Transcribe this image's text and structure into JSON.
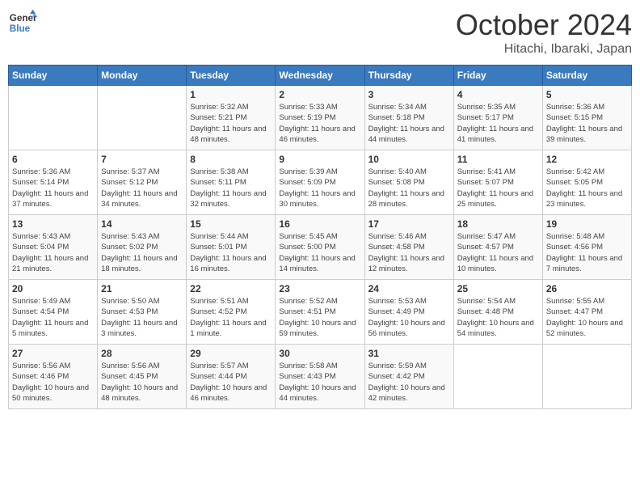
{
  "header": {
    "logo_line1": "General",
    "logo_line2": "Blue",
    "month": "October 2024",
    "location": "Hitachi, Ibaraki, Japan"
  },
  "weekdays": [
    "Sunday",
    "Monday",
    "Tuesday",
    "Wednesday",
    "Thursday",
    "Friday",
    "Saturday"
  ],
  "weeks": [
    [
      {
        "day": "",
        "sunrise": "",
        "sunset": "",
        "daylight": ""
      },
      {
        "day": "",
        "sunrise": "",
        "sunset": "",
        "daylight": ""
      },
      {
        "day": "1",
        "sunrise": "Sunrise: 5:32 AM",
        "sunset": "Sunset: 5:21 PM",
        "daylight": "Daylight: 11 hours and 48 minutes."
      },
      {
        "day": "2",
        "sunrise": "Sunrise: 5:33 AM",
        "sunset": "Sunset: 5:19 PM",
        "daylight": "Daylight: 11 hours and 46 minutes."
      },
      {
        "day": "3",
        "sunrise": "Sunrise: 5:34 AM",
        "sunset": "Sunset: 5:18 PM",
        "daylight": "Daylight: 11 hours and 44 minutes."
      },
      {
        "day": "4",
        "sunrise": "Sunrise: 5:35 AM",
        "sunset": "Sunset: 5:17 PM",
        "daylight": "Daylight: 11 hours and 41 minutes."
      },
      {
        "day": "5",
        "sunrise": "Sunrise: 5:36 AM",
        "sunset": "Sunset: 5:15 PM",
        "daylight": "Daylight: 11 hours and 39 minutes."
      }
    ],
    [
      {
        "day": "6",
        "sunrise": "Sunrise: 5:36 AM",
        "sunset": "Sunset: 5:14 PM",
        "daylight": "Daylight: 11 hours and 37 minutes."
      },
      {
        "day": "7",
        "sunrise": "Sunrise: 5:37 AM",
        "sunset": "Sunset: 5:12 PM",
        "daylight": "Daylight: 11 hours and 34 minutes."
      },
      {
        "day": "8",
        "sunrise": "Sunrise: 5:38 AM",
        "sunset": "Sunset: 5:11 PM",
        "daylight": "Daylight: 11 hours and 32 minutes."
      },
      {
        "day": "9",
        "sunrise": "Sunrise: 5:39 AM",
        "sunset": "Sunset: 5:09 PM",
        "daylight": "Daylight: 11 hours and 30 minutes."
      },
      {
        "day": "10",
        "sunrise": "Sunrise: 5:40 AM",
        "sunset": "Sunset: 5:08 PM",
        "daylight": "Daylight: 11 hours and 28 minutes."
      },
      {
        "day": "11",
        "sunrise": "Sunrise: 5:41 AM",
        "sunset": "Sunset: 5:07 PM",
        "daylight": "Daylight: 11 hours and 25 minutes."
      },
      {
        "day": "12",
        "sunrise": "Sunrise: 5:42 AM",
        "sunset": "Sunset: 5:05 PM",
        "daylight": "Daylight: 11 hours and 23 minutes."
      }
    ],
    [
      {
        "day": "13",
        "sunrise": "Sunrise: 5:43 AM",
        "sunset": "Sunset: 5:04 PM",
        "daylight": "Daylight: 11 hours and 21 minutes."
      },
      {
        "day": "14",
        "sunrise": "Sunrise: 5:43 AM",
        "sunset": "Sunset: 5:02 PM",
        "daylight": "Daylight: 11 hours and 18 minutes."
      },
      {
        "day": "15",
        "sunrise": "Sunrise: 5:44 AM",
        "sunset": "Sunset: 5:01 PM",
        "daylight": "Daylight: 11 hours and 16 minutes."
      },
      {
        "day": "16",
        "sunrise": "Sunrise: 5:45 AM",
        "sunset": "Sunset: 5:00 PM",
        "daylight": "Daylight: 11 hours and 14 minutes."
      },
      {
        "day": "17",
        "sunrise": "Sunrise: 5:46 AM",
        "sunset": "Sunset: 4:58 PM",
        "daylight": "Daylight: 11 hours and 12 minutes."
      },
      {
        "day": "18",
        "sunrise": "Sunrise: 5:47 AM",
        "sunset": "Sunset: 4:57 PM",
        "daylight": "Daylight: 11 hours and 10 minutes."
      },
      {
        "day": "19",
        "sunrise": "Sunrise: 5:48 AM",
        "sunset": "Sunset: 4:56 PM",
        "daylight": "Daylight: 11 hours and 7 minutes."
      }
    ],
    [
      {
        "day": "20",
        "sunrise": "Sunrise: 5:49 AM",
        "sunset": "Sunset: 4:54 PM",
        "daylight": "Daylight: 11 hours and 5 minutes."
      },
      {
        "day": "21",
        "sunrise": "Sunrise: 5:50 AM",
        "sunset": "Sunset: 4:53 PM",
        "daylight": "Daylight: 11 hours and 3 minutes."
      },
      {
        "day": "22",
        "sunrise": "Sunrise: 5:51 AM",
        "sunset": "Sunset: 4:52 PM",
        "daylight": "Daylight: 11 hours and 1 minute."
      },
      {
        "day": "23",
        "sunrise": "Sunrise: 5:52 AM",
        "sunset": "Sunset: 4:51 PM",
        "daylight": "Daylight: 10 hours and 59 minutes."
      },
      {
        "day": "24",
        "sunrise": "Sunrise: 5:53 AM",
        "sunset": "Sunset: 4:49 PM",
        "daylight": "Daylight: 10 hours and 56 minutes."
      },
      {
        "day": "25",
        "sunrise": "Sunrise: 5:54 AM",
        "sunset": "Sunset: 4:48 PM",
        "daylight": "Daylight: 10 hours and 54 minutes."
      },
      {
        "day": "26",
        "sunrise": "Sunrise: 5:55 AM",
        "sunset": "Sunset: 4:47 PM",
        "daylight": "Daylight: 10 hours and 52 minutes."
      }
    ],
    [
      {
        "day": "27",
        "sunrise": "Sunrise: 5:56 AM",
        "sunset": "Sunset: 4:46 PM",
        "daylight": "Daylight: 10 hours and 50 minutes."
      },
      {
        "day": "28",
        "sunrise": "Sunrise: 5:56 AM",
        "sunset": "Sunset: 4:45 PM",
        "daylight": "Daylight: 10 hours and 48 minutes."
      },
      {
        "day": "29",
        "sunrise": "Sunrise: 5:57 AM",
        "sunset": "Sunset: 4:44 PM",
        "daylight": "Daylight: 10 hours and 46 minutes."
      },
      {
        "day": "30",
        "sunrise": "Sunrise: 5:58 AM",
        "sunset": "Sunset: 4:43 PM",
        "daylight": "Daylight: 10 hours and 44 minutes."
      },
      {
        "day": "31",
        "sunrise": "Sunrise: 5:59 AM",
        "sunset": "Sunset: 4:42 PM",
        "daylight": "Daylight: 10 hours and 42 minutes."
      },
      {
        "day": "",
        "sunrise": "",
        "sunset": "",
        "daylight": ""
      },
      {
        "day": "",
        "sunrise": "",
        "sunset": "",
        "daylight": ""
      }
    ]
  ]
}
